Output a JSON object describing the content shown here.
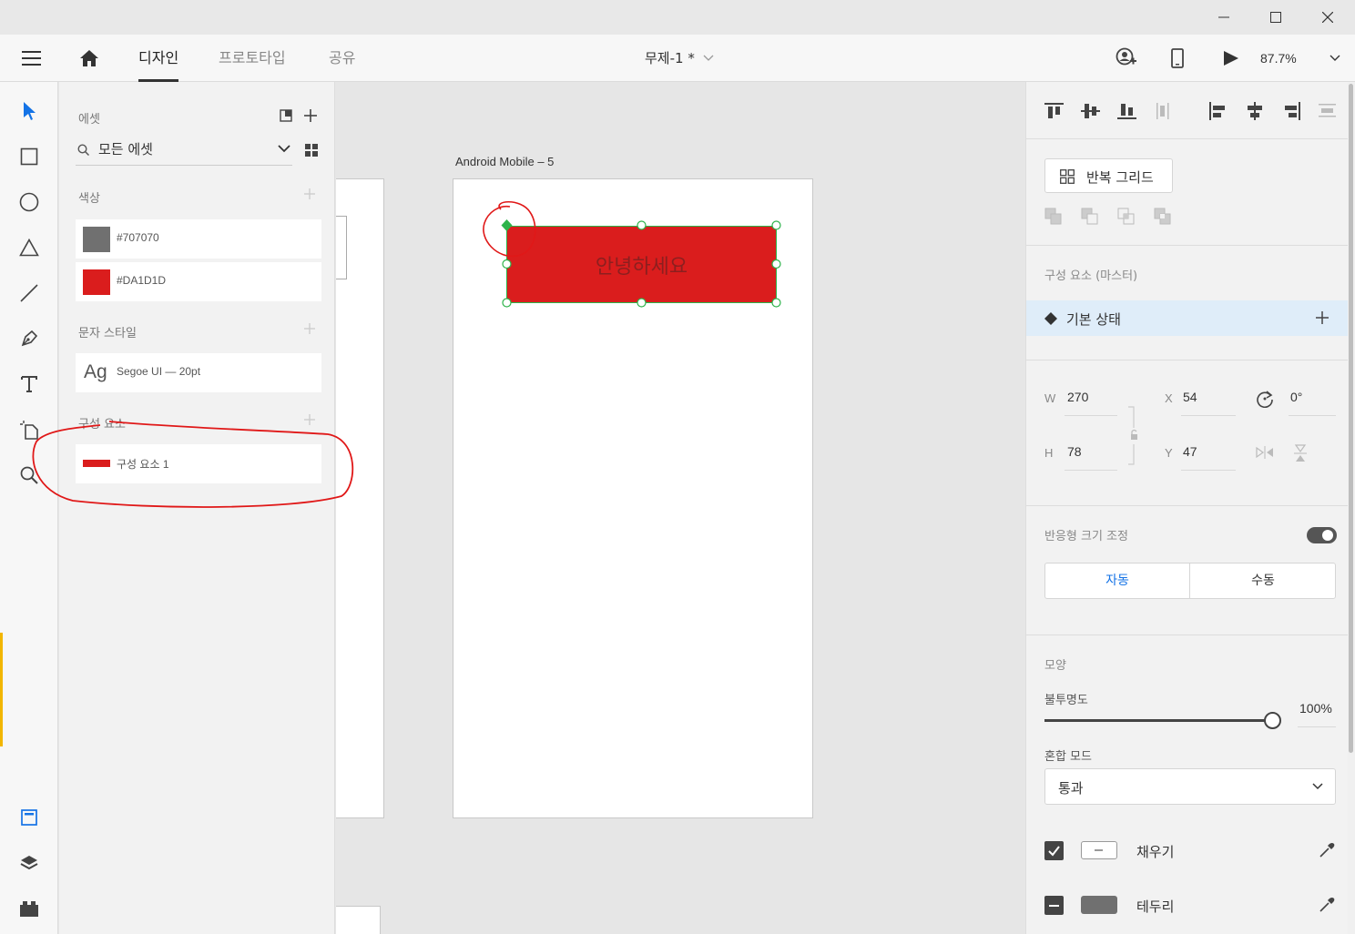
{
  "header": {
    "tabs": [
      {
        "label": "디자인",
        "active": true
      },
      {
        "label": "프로토타입",
        "active": false
      },
      {
        "label": "공유",
        "active": false
      }
    ],
    "doc_title": "무제-1 *",
    "zoom": "87.7%"
  },
  "assets": {
    "title": "에셋",
    "search_value": "모든 에셋",
    "colors_label": "색상",
    "colors": [
      {
        "label": "#707070",
        "hex": "#707070"
      },
      {
        "label": "#DA1D1D",
        "hex": "#DA1D1D"
      }
    ],
    "text_styles_label": "문자 스타일",
    "text_style": {
      "sample": "Ag",
      "label": "Segoe UI — 20pt"
    },
    "components_label": "구성 요소",
    "component": {
      "label": "구성 요소 1"
    }
  },
  "canvas": {
    "artboard_name": "Android Mobile – 5",
    "button_text": "안녕하세요",
    "button_color": "#DA1D1D",
    "selection_color": "#2DB34A"
  },
  "props": {
    "repeat_grid": "반복 그리드",
    "component_header": "구성 요소 (마스터)",
    "default_state": "기본 상태",
    "w_label": "W",
    "w_value": "270",
    "h_label": "H",
    "h_value": "78",
    "x_label": "X",
    "x_value": "54",
    "y_label": "Y",
    "y_value": "47",
    "rotation": "0°",
    "responsive_label": "반응형 크기 조정",
    "auto": "자동",
    "manual": "수동",
    "appearance_label": "모양",
    "opacity_label": "불투명도",
    "opacity_value": "100%",
    "opacity_fraction": 1.0,
    "blend_label": "혼합 모드",
    "blend_value": "통과",
    "fill_label": "채우기",
    "border_label": "테두리"
  },
  "annotation_color": "#E01818"
}
